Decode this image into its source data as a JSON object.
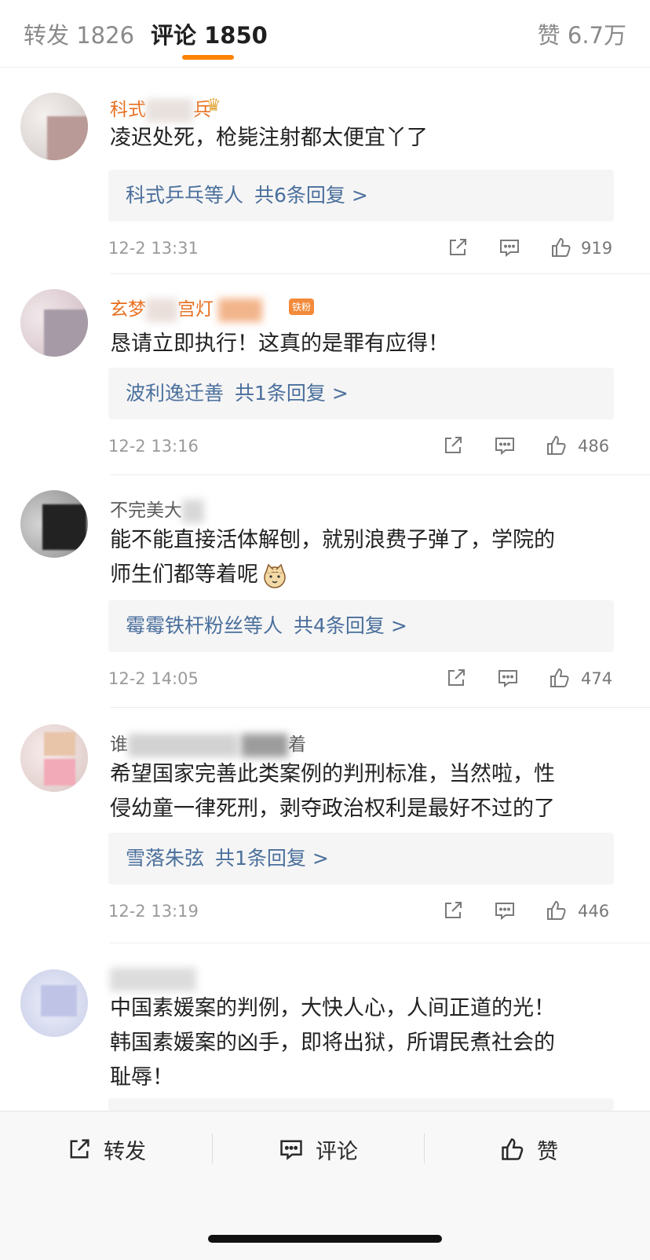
{
  "tabs": {
    "repost_label": "转发 1826",
    "comment_label": "评论 1850",
    "like_label": "赞 6.7万"
  },
  "colors": {
    "accent": "#ff8200",
    "username_vip": "#e86f1f",
    "reply_link": "#4a6f9c"
  },
  "comments": [
    {
      "username_visible": "科式",
      "username_tail": "兵",
      "text": "凌迟处死，枪毙注射都太便宜丫了",
      "reply_names": "科式乒乓等人",
      "reply_count": "共6条回复 >",
      "time": "12-2 13:31",
      "likes": "919",
      "icons": [
        "share-icon",
        "comment-icon",
        "like-icon"
      ]
    },
    {
      "username_visible": "玄梦",
      "username_tail": "宫灯",
      "badge": "铁粉",
      "text": "恳请立即执行！这真的是罪有应得！",
      "reply_names": "波利逸迁善",
      "reply_count": "共1条回复 >",
      "time": "12-2 13:16",
      "likes": "486"
    },
    {
      "username_visible": "不完美大",
      "text_line1": "能不能直接活体解刨，就别浪费子弹了，学院的",
      "text_line2": "师生们都等着呢",
      "reply_names": "霉霉铁杆粉丝等人",
      "reply_count": "共4条回复 >",
      "time": "12-2 14:05",
      "likes": "474"
    },
    {
      "username_visible": "谁",
      "username_tail": "着",
      "text_line1": "希望国家完善此类案例的判刑标准，当然啦，性",
      "text_line2": "侵幼童一律死刑，剥夺政治权利是最好不过的了",
      "reply_names": "雪落朱弦",
      "reply_count": "共1条回复 >",
      "time": "12-2 13:19",
      "likes": "446"
    },
    {
      "username_visible": "",
      "text_line1": "中国素媛案的判例，大快人心，人间正道的光！",
      "text_line2": "韩国素媛案的凶手，即将出狱，所谓民煮社会的",
      "text_line3": "耻辱！"
    }
  ],
  "bottom_bar": {
    "repost": "转发",
    "comment": "评论",
    "like": "赞"
  }
}
